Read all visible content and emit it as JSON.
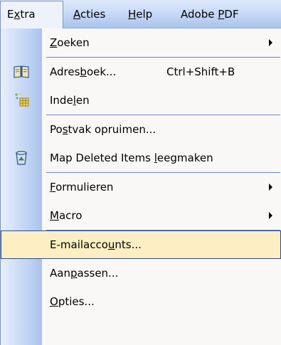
{
  "menubar": {
    "items": [
      {
        "pre": "E",
        "acc": "x",
        "post": "tra"
      },
      {
        "pre": "",
        "acc": "A",
        "post": "cties"
      },
      {
        "pre": "",
        "acc": "H",
        "post": "elp"
      },
      {
        "pre": "Adobe ",
        "acc": "P",
        "post": "DF"
      }
    ]
  },
  "menu": {
    "items": [
      {
        "pre": "",
        "acc": "Z",
        "post": "oeken"
      },
      {
        "pre": "Adres",
        "acc": "b",
        "post": "oek...",
        "shortcut": "Ctrl+Shift+B"
      },
      {
        "pre": "Inde",
        "acc": "l",
        "post": "en"
      },
      {
        "pre": "Po",
        "acc": "s",
        "post": "tvak opruimen..."
      },
      {
        "pre": "Map Deleted Items ",
        "acc": "l",
        "post": "eegmaken"
      },
      {
        "pre": "",
        "acc": "F",
        "post": "ormulieren"
      },
      {
        "pre": "",
        "acc": "M",
        "post": "acro"
      },
      {
        "pre": "E-mailacco",
        "acc": "u",
        "post": "nts..."
      },
      {
        "pre": "Aan",
        "acc": "p",
        "post": "assen..."
      },
      {
        "pre": "",
        "acc": "O",
        "post": "pties..."
      }
    ]
  },
  "icons": {
    "address_book": "address-book-icon",
    "organize": "organize-icon",
    "empty_deleted": "recycle-bin-icon"
  },
  "colors": {
    "highlight_fill": "#fdeec4",
    "highlight_border": "#2c4b8c",
    "gutter": "#c4d6f4",
    "separator": "#6c89c4"
  }
}
